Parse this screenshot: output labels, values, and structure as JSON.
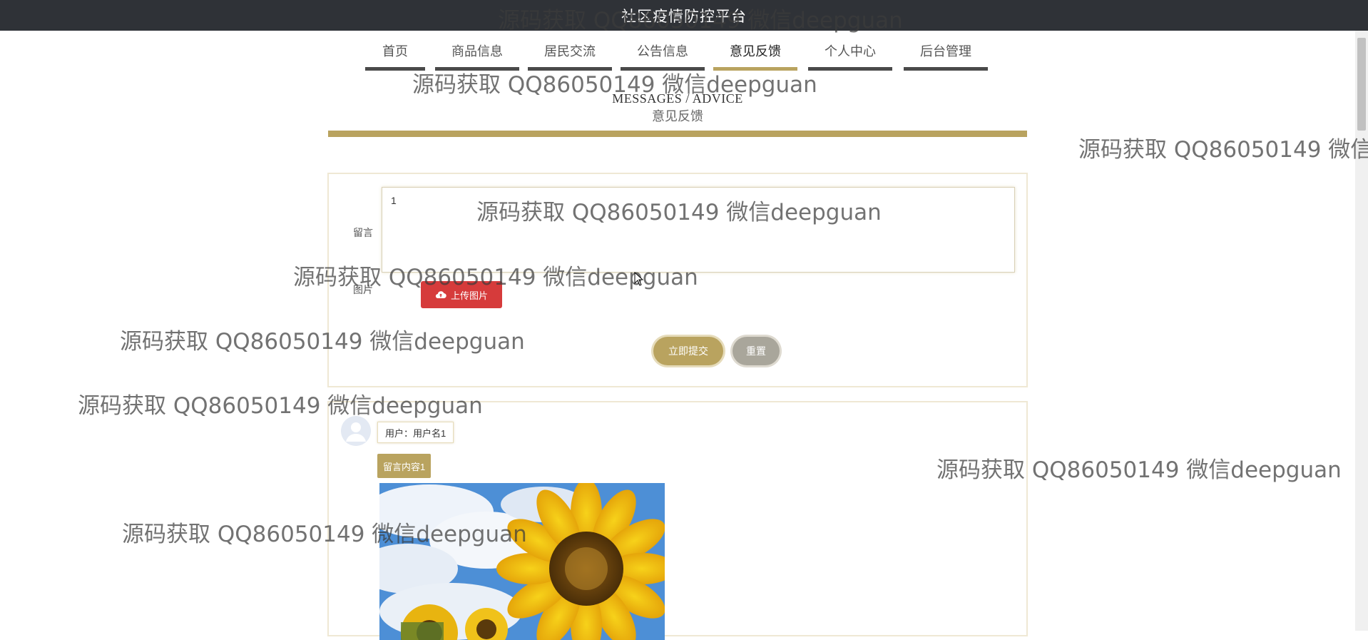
{
  "header": {
    "title": "社区疫情防控平台"
  },
  "nav": {
    "items": [
      {
        "label": "首页",
        "active": false
      },
      {
        "label": "商品信息",
        "active": false
      },
      {
        "label": "居民交流",
        "active": false
      },
      {
        "label": "公告信息",
        "active": false
      },
      {
        "label": "意见反馈",
        "active": true
      },
      {
        "label": "个人中心",
        "active": false
      },
      {
        "label": "后台管理",
        "active": false
      }
    ]
  },
  "section": {
    "title_en": "MESSAGES / ADVICE",
    "title_cn": "意见反馈"
  },
  "form": {
    "message_label": "留言",
    "message_value": "1",
    "image_label": "图片",
    "upload_label": "上传图片",
    "submit_label": "立即提交",
    "reset_label": "重置"
  },
  "comments": [
    {
      "user": "用户：用户名1",
      "content": "留言内容1",
      "image": "sunflower-photo"
    }
  ],
  "watermark": {
    "text": "源码获取 QQ86050149 微信deepguan"
  },
  "colors": {
    "gold": "#b9a35f",
    "topbar": "#2f3237",
    "upload_red": "#d63b3b",
    "reset_gray": "#a9a69b"
  }
}
